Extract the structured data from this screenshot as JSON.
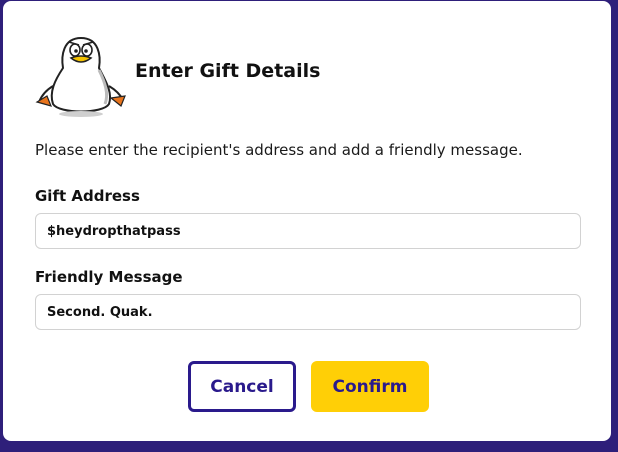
{
  "dialog": {
    "title": "Enter Gift Details",
    "description": "Please enter the recipient's address and add a friendly message.",
    "mascot_icon": "penguin-mascot-icon"
  },
  "fields": {
    "gift_address": {
      "label": "Gift Address",
      "value": "$heydropthatpass"
    },
    "friendly_message": {
      "label": "Friendly Message",
      "value": "Second. Quak."
    }
  },
  "actions": {
    "cancel_label": "Cancel",
    "confirm_label": "Confirm"
  },
  "colors": {
    "backdrop": "#2e1f7a",
    "accent": "#2a1a8c",
    "confirm_bg": "#ffcf06"
  }
}
